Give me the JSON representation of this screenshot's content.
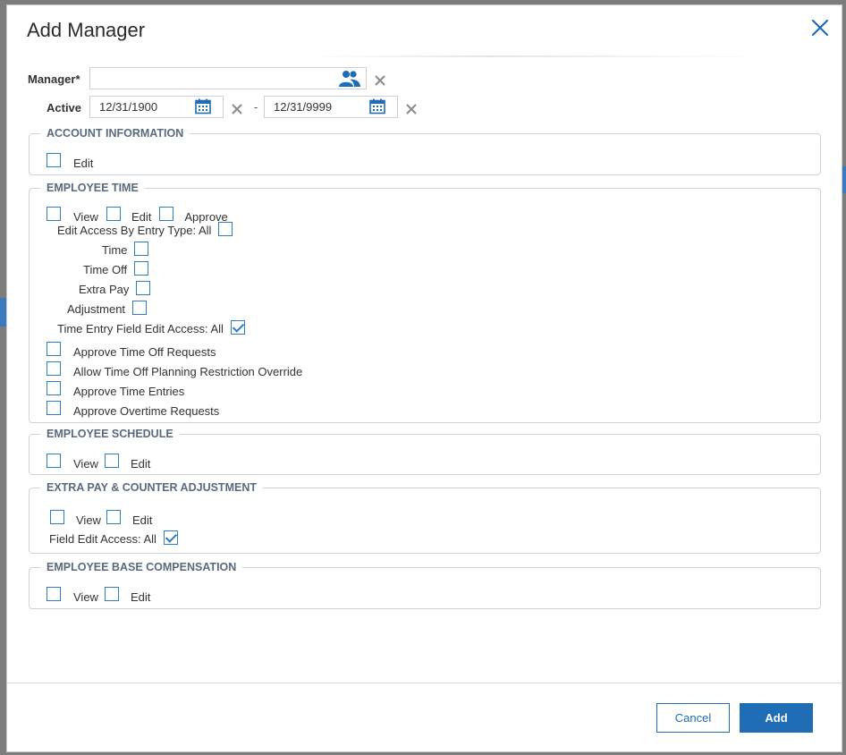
{
  "dialog": {
    "title": "Add Manager",
    "close_icon": "close-icon"
  },
  "manager": {
    "label": "Manager*",
    "value": "",
    "picker_icon": "users-icon",
    "clear_icon": "clear-icon"
  },
  "active": {
    "label": "Active",
    "start": "12/31/1900",
    "end": "12/31/9999",
    "separator": "-",
    "calendar_icon": "calendar-icon",
    "clear_icon": "clear-icon"
  },
  "account_information": {
    "legend": "ACCOUNT INFORMATION",
    "edit": {
      "label": "Edit",
      "checked": false
    }
  },
  "employee_time": {
    "legend": "EMPLOYEE TIME",
    "view": {
      "label": "View",
      "checked": false
    },
    "edit": {
      "label": "Edit",
      "checked": false
    },
    "approve": {
      "label": "Approve",
      "checked": false
    },
    "edit_access_by_entry_type": {
      "label": "Edit Access By Entry Type: All",
      "checked": false
    },
    "time": {
      "label": "Time",
      "checked": false
    },
    "time_off": {
      "label": "Time Off",
      "checked": false
    },
    "extra_pay": {
      "label": "Extra Pay",
      "checked": false
    },
    "adjustment": {
      "label": "Adjustment",
      "checked": false
    },
    "time_entry_field_edit_access": {
      "label": "Time Entry Field Edit Access: All",
      "checked": true
    },
    "approve_time_off_requests": {
      "label": "Approve Time Off Requests",
      "checked": false
    },
    "allow_time_off_planning_override": {
      "label": "Allow Time Off Planning Restriction Override",
      "checked": false
    },
    "approve_time_entries": {
      "label": "Approve Time Entries",
      "checked": false
    },
    "approve_overtime_requests": {
      "label": "Approve Overtime Requests",
      "checked": false
    }
  },
  "employee_schedule": {
    "legend": "EMPLOYEE SCHEDULE",
    "view": {
      "label": "View",
      "checked": false
    },
    "edit": {
      "label": "Edit",
      "checked": false
    }
  },
  "extra_pay_counter_adjustment": {
    "legend": "EXTRA PAY & COUNTER ADJUSTMENT",
    "view": {
      "label": "View",
      "checked": false
    },
    "edit": {
      "label": "Edit",
      "checked": false
    },
    "field_edit_access": {
      "label": "Field Edit Access: All",
      "checked": true
    }
  },
  "employee_base_compensation": {
    "legend": "EMPLOYEE BASE COMPENSATION",
    "view": {
      "label": "View",
      "checked": false
    },
    "edit": {
      "label": "Edit",
      "checked": false
    }
  },
  "footer": {
    "cancel_label": "Cancel",
    "add_label": "Add"
  },
  "colors": {
    "accent": "#1f6db5",
    "checkbox_border": "#2f7dc4",
    "legend_text": "#5a6a7d"
  }
}
